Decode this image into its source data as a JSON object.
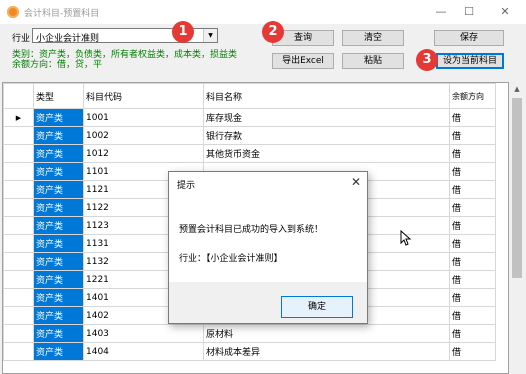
{
  "window": {
    "title": "会计科目-预置科目",
    "minimize": "—",
    "maximize": "☐",
    "close": "✕"
  },
  "toolbar": {
    "industry_label": "行业",
    "industry_value": "小企业会计准则",
    "hint_line1": "类别：资产类，负债类，所有者权益类，成本类，损益类",
    "hint_line2": "余额方向：借，贷，平",
    "query_button": "查询",
    "clear_button": "清空",
    "save_button": "保存",
    "export_button": "导出Excel",
    "paste_button": "粘贴",
    "set_current_button": "设为当前科目"
  },
  "badges": [
    "1",
    "2",
    "3"
  ],
  "grid": {
    "columns": [
      "类型",
      "科目代码",
      "科目名称",
      "余额方向"
    ],
    "rows": [
      [
        "资产类",
        "1001",
        "库存现金",
        "借"
      ],
      [
        "资产类",
        "1002",
        "银行存款",
        "借"
      ],
      [
        "资产类",
        "1012",
        "其他货币资金",
        "借"
      ],
      [
        "资产类",
        "1101",
        "",
        "借"
      ],
      [
        "资产类",
        "1121",
        "",
        "借"
      ],
      [
        "资产类",
        "1122",
        "",
        "借"
      ],
      [
        "资产类",
        "1123",
        "",
        "借"
      ],
      [
        "资产类",
        "1131",
        "",
        "借"
      ],
      [
        "资产类",
        "1132",
        "",
        "借"
      ],
      [
        "资产类",
        "1221",
        "",
        "借"
      ],
      [
        "资产类",
        "1401",
        "",
        "借"
      ],
      [
        "资产类",
        "1402",
        "",
        "借"
      ],
      [
        "资产类",
        "1403",
        "原材料",
        "借"
      ],
      [
        "资产类",
        "1404",
        "材料成本差异",
        "借"
      ]
    ]
  },
  "dialog": {
    "title": "提示",
    "message": "预置会计科目已成功的导入到系统！",
    "industry_line": "行业：【小企业会计准则】",
    "ok_button": "确定"
  }
}
